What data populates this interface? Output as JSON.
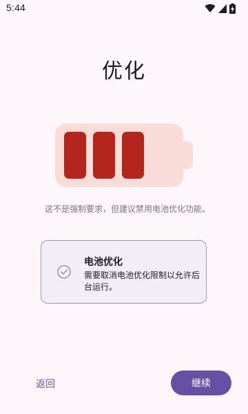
{
  "status_bar": {
    "time": "5:44",
    "icons": [
      "wifi-icon",
      "cellular-signal-icon",
      "battery-charging-icon"
    ]
  },
  "title": "优化",
  "battery_illustration": {
    "icon": "battery-icon",
    "body_color": "#f9dcd8",
    "cell_color": "#b3261e",
    "filled_cells": 3
  },
  "hint": "这不是强制要求，但建议禁用电池优化功能。",
  "option": {
    "icon": "check-circle-icon",
    "title": "电池优化",
    "description": "需要取消电池优化限制以允许后台运行。"
  },
  "actions": {
    "back_label": "返回",
    "continue_label": "继续"
  },
  "colors": {
    "primary": "#6750a4",
    "background": "#fdf7fc"
  }
}
